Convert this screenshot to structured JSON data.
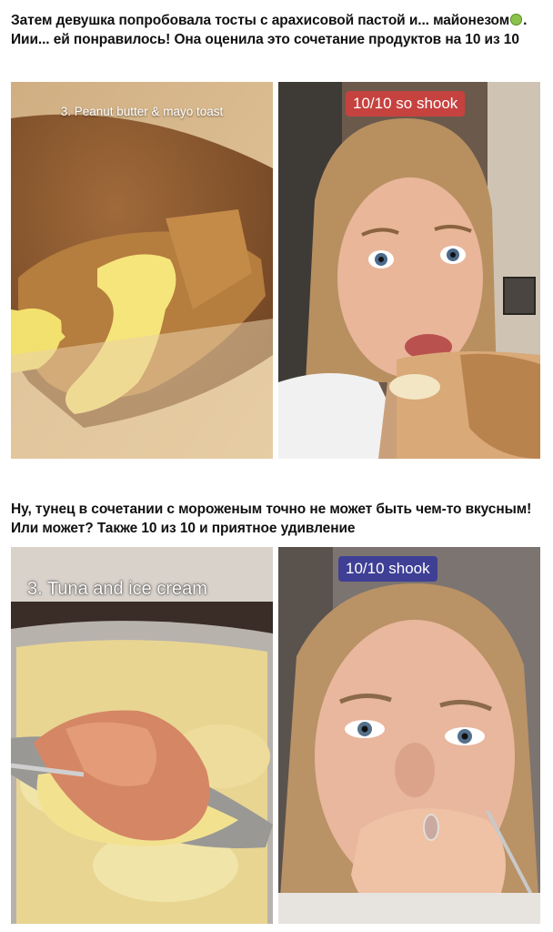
{
  "sections": [
    {
      "caption_before_emoji": "Затем девушка попробовала тосты с арахисовой пастой и... майонезом",
      "caption_after_emoji": ". Иии... ей понравилось! Она оценила это сочетание продуктов на 10 из 10",
      "left_photo_label": "3. Peanut butter & mayo toast",
      "right_photo_badge": "10/10 so shook"
    },
    {
      "caption": "Ну, тунец в сочетании с мороженым точно не может быть чем-то вкусным! Или может? Также 10 из 10 и приятное удивление",
      "left_photo_label": "3. Tuna and ice cream",
      "right_photo_badge": "10/10 shook"
    }
  ],
  "colors": {
    "badge_red": "#c6423f",
    "badge_blue": "#3e3f95"
  },
  "icons": [
    "nauseated-face-emoji"
  ]
}
